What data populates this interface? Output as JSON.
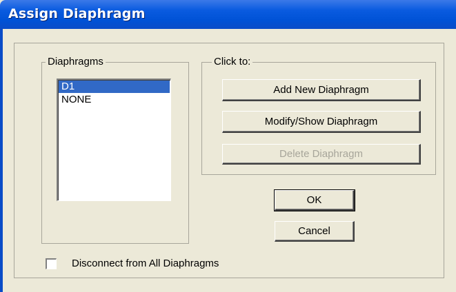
{
  "window": {
    "title": "Assign Diaphragm"
  },
  "diaphragms": {
    "legend": "Diaphragms",
    "items": [
      {
        "label": "D1",
        "selected": true
      },
      {
        "label": "NONE",
        "selected": false
      }
    ]
  },
  "actions": {
    "legend": "Click to:",
    "add_label": "Add New Diaphragm",
    "modify_label": "Modify/Show Diaphragm",
    "delete_label": "Delete Diaphragm",
    "delete_enabled": false
  },
  "buttons": {
    "ok_label": "OK",
    "cancel_label": "Cancel"
  },
  "disconnect": {
    "label": "Disconnect from All Diaphragms",
    "checked": false
  },
  "colors": {
    "titlebar": "#0A5BE0",
    "selection": "#3169C6",
    "dialog_bg": "#ECE9D8"
  }
}
